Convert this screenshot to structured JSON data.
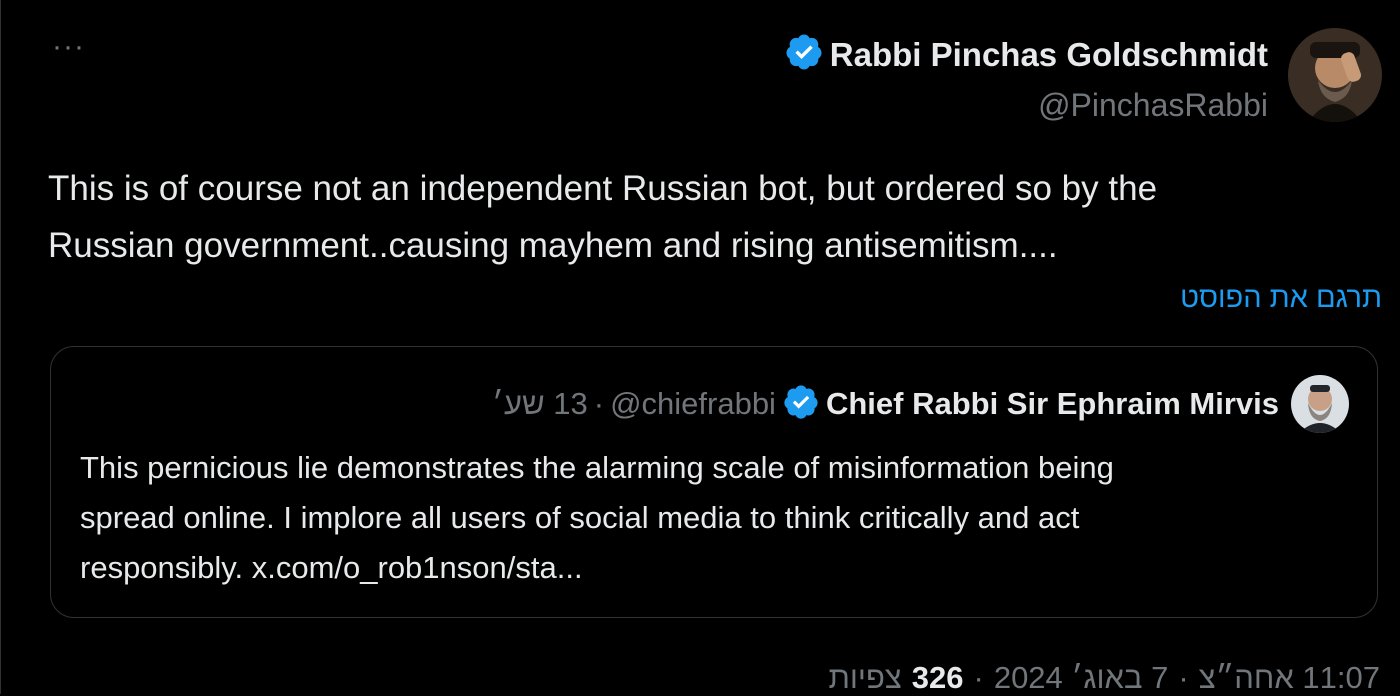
{
  "tweet": {
    "more_icon": "more-horizontal-icon",
    "author": {
      "name": "Rabbi Pinchas Goldschmidt",
      "handle": "@PinchasRabbi",
      "verified_icon": "verified-badge-icon",
      "verified_color": "#1d9bf0"
    },
    "text_line1": "This is of course not an independent Russian bot, but ordered so by the",
    "text_line2": "Russian government..causing mayhem and rising antisemitism....",
    "translate_label": "תרגם את הפוסט",
    "quote": {
      "name": "Chief Rabbi Sir Ephraim Mirvis",
      "handle": "@chiefrabbi",
      "separator": "·",
      "time": "13 שע׳",
      "text_line1": "This pernicious lie demonstrates the alarming scale of misinformation being",
      "text_line2": "spread online. I implore all users of social media to think critically and act",
      "text_line3": "responsibly. x.com/o_rob1nson/sta..."
    },
    "meta": {
      "time": "11:07 אחה״צ",
      "sep1": "·",
      "date": "7 באוג׳ 2024",
      "sep2": "·",
      "views_count": "326",
      "views_label": "צפיות"
    }
  },
  "colors": {
    "background": "#000000",
    "text": "#e7e9ea",
    "secondary": "#71767b",
    "accent": "#1d9bf0",
    "border": "#2f3336"
  }
}
